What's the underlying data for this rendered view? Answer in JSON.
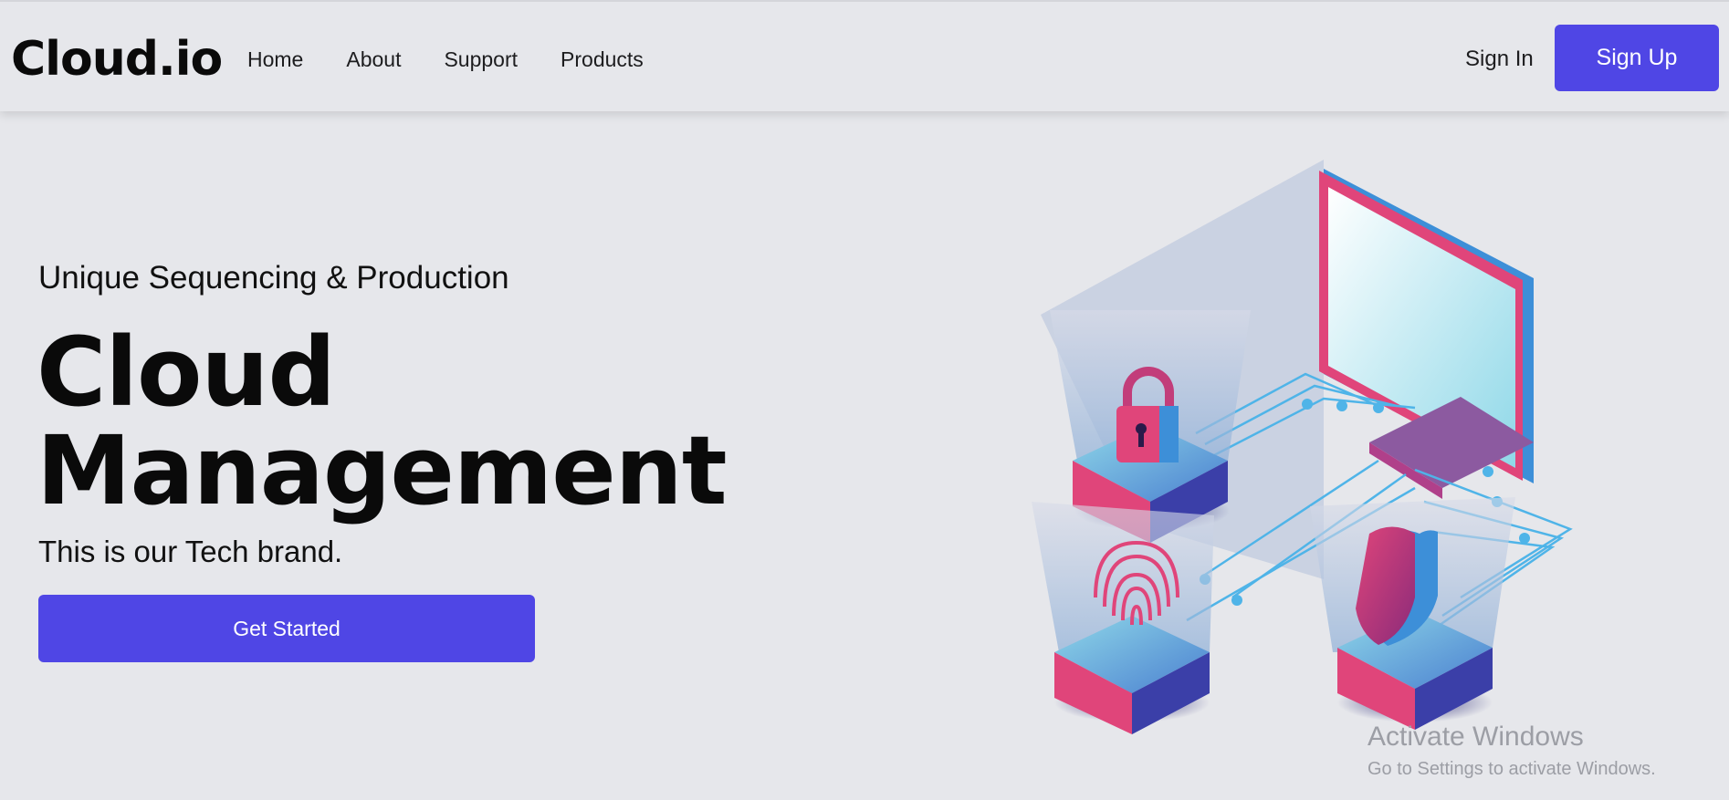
{
  "navbar": {
    "brand": "Cloud.io",
    "links": [
      "Home",
      "About",
      "Support",
      "Products"
    ],
    "sign_in": "Sign In",
    "sign_up": "Sign Up"
  },
  "hero": {
    "subtitle": "Unique Sequencing & Production",
    "title_line1": "Cloud",
    "title_line2": "Management",
    "tagline": "This is our Tech brand.",
    "cta": "Get Started"
  },
  "illustration": {
    "icons": [
      "padlock-icon",
      "fingerprint-icon",
      "shield-icon",
      "monitor-icon"
    ],
    "colors": {
      "pink": "#e0457a",
      "blue": "#3d8fd8",
      "indigo": "#3b3fa8",
      "cyan": "#8fd8e8"
    }
  },
  "watermark": {
    "title": "Activate Windows",
    "subtitle": "Go to Settings to activate Windows."
  },
  "colors": {
    "accent": "#4f46e5",
    "background": "#e6e7eb"
  }
}
